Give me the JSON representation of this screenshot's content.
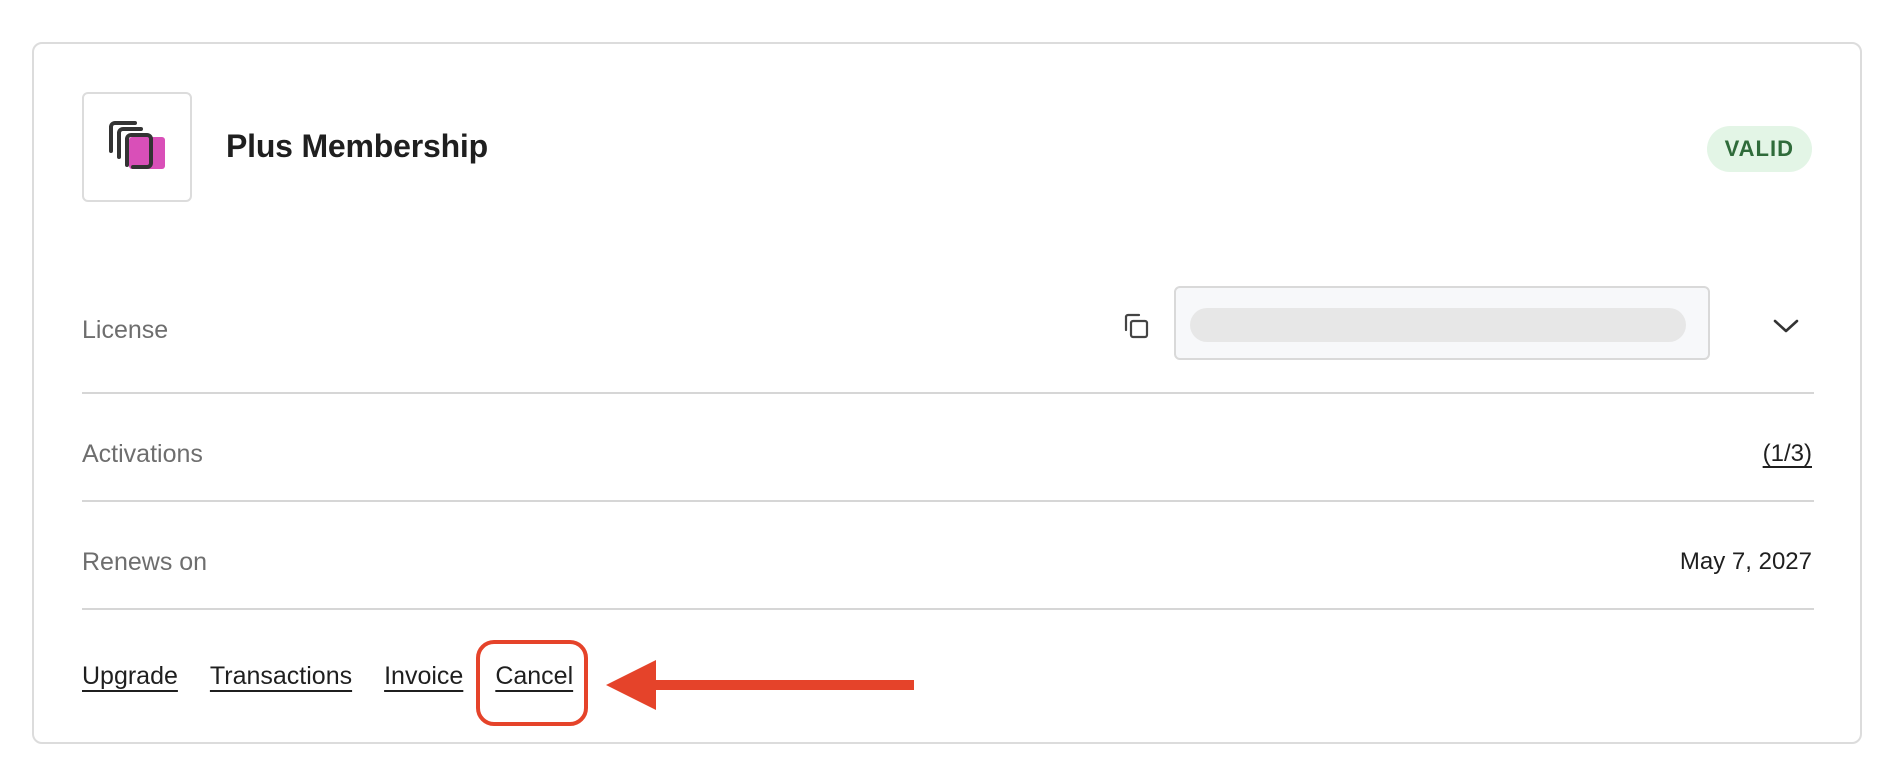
{
  "product": {
    "title": "Plus Membership",
    "logo_icon": "stacked-cards-icon",
    "accent_color": "#d94fb8"
  },
  "status": {
    "label": "VALID",
    "color": "#2f6b3a",
    "background": "#e3f5e6"
  },
  "license": {
    "label": "License",
    "copy_icon": "copy-icon",
    "expand_icon": "chevron-down-icon"
  },
  "activations": {
    "label": "Activations",
    "value": "(1/3)"
  },
  "renewal": {
    "label": "Renews on",
    "value": "May 7, 2027"
  },
  "actions": {
    "upgrade": "Upgrade",
    "transactions": "Transactions",
    "invoice": "Invoice",
    "cancel": "Cancel"
  },
  "annotation": {
    "highlight_color": "#e5432a"
  }
}
